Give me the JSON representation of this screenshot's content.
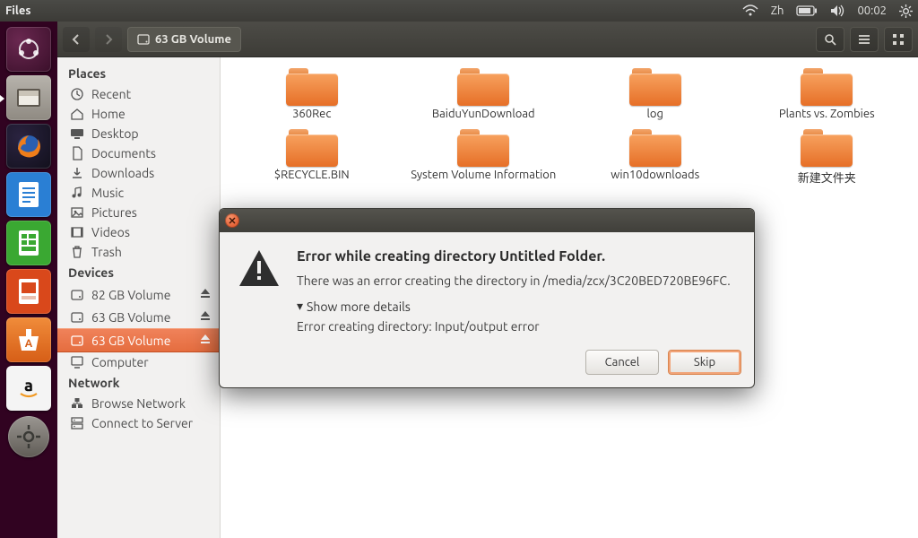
{
  "menubar": {
    "app_name": "Files",
    "ime": "Zh",
    "clock": "00:02"
  },
  "toolbar": {
    "location_label": "63 GB Volume"
  },
  "sidebar": {
    "places_title": "Places",
    "places": [
      {
        "icon": "recent",
        "label": "Recent"
      },
      {
        "icon": "home",
        "label": "Home"
      },
      {
        "icon": "desktop",
        "label": "Desktop"
      },
      {
        "icon": "doc",
        "label": "Documents"
      },
      {
        "icon": "down",
        "label": "Downloads"
      },
      {
        "icon": "music",
        "label": "Music"
      },
      {
        "icon": "pic",
        "label": "Pictures"
      },
      {
        "icon": "video",
        "label": "Videos"
      },
      {
        "icon": "trash",
        "label": "Trash"
      }
    ],
    "devices_title": "Devices",
    "devices": [
      {
        "label": "82 GB Volume",
        "eject": true,
        "active": false
      },
      {
        "label": "63 GB Volume",
        "eject": true,
        "active": false
      },
      {
        "label": "63 GB Volume",
        "eject": true,
        "active": true
      },
      {
        "label": "Computer",
        "eject": false,
        "active": false
      }
    ],
    "network_title": "Network",
    "network": [
      {
        "label": "Browse Network"
      },
      {
        "label": "Connect to Server"
      }
    ]
  },
  "folders": [
    "360Rec",
    "BaiduYunDownload",
    "log",
    "Plants vs. Zombies",
    "$RECYCLE.BIN",
    "System Volume Information",
    "win10downloads",
    "新建文件夹"
  ],
  "dialog": {
    "title": "Error while creating directory Untitled Folder.",
    "message": "There was an error creating the directory in /media/zcx/3C20BED720BE96FC.",
    "expander_label": "Show more details",
    "detail": "Error creating directory: Input/output error",
    "cancel": "Cancel",
    "skip": "Skip"
  }
}
